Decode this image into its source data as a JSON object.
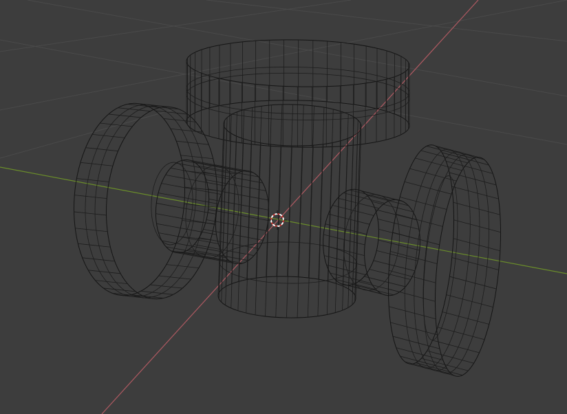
{
  "viewport": {
    "mode": "wireframe",
    "view": "perspective",
    "background_color": "#3d3d3d",
    "grid_color": "#4a4a4a",
    "wire_color": "#141414",
    "x_axis_color": "#b05a62",
    "y_axis_color": "#6b8e2a",
    "cursor_colors": [
      "#c8322e",
      "#ffffff"
    ],
    "objects": [
      {
        "name": "central-cylinder",
        "kind": "cylinder"
      },
      {
        "name": "top-ring",
        "kind": "ring"
      },
      {
        "name": "left-wheel",
        "kind": "wheel"
      },
      {
        "name": "left-axle",
        "kind": "cylinder"
      },
      {
        "name": "right-axle",
        "kind": "cylinder"
      },
      {
        "name": "right-wheel",
        "kind": "wheel"
      }
    ],
    "icons": {
      "cursor": "3d-cursor-icon"
    }
  }
}
